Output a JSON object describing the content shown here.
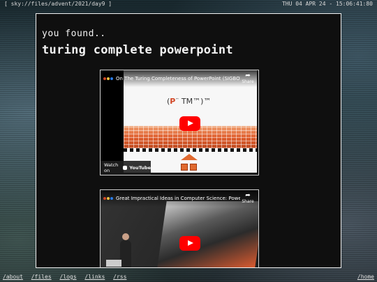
{
  "topbar": {
    "path": "[ sky://files/advent/2021/day9 ]",
    "datetime": "THU 04 APR 24 - 15:06:41:80"
  },
  "main": {
    "kicker": "you found..",
    "title": "turing complete powerpoint"
  },
  "videos": [
    {
      "title": "On The Turing Completeness of PowerPoint (SIGBOVIK)",
      "share_label": "Share",
      "watch_on_label": "Watch on",
      "platform_label": "YouTube",
      "slide_text": "TM™)™"
    },
    {
      "title": "Great Impractical Ideas in Computer Science: PowerPoi...",
      "share_label": "Share"
    }
  ],
  "footer": {
    "links": [
      "/about",
      "/files",
      "/logs",
      "/links",
      "/rss"
    ],
    "home": "/home"
  },
  "colors": {
    "panel_border": "#f0f0f0",
    "youtube_red": "#ff0000",
    "powerpoint_orange": "#d24726"
  }
}
